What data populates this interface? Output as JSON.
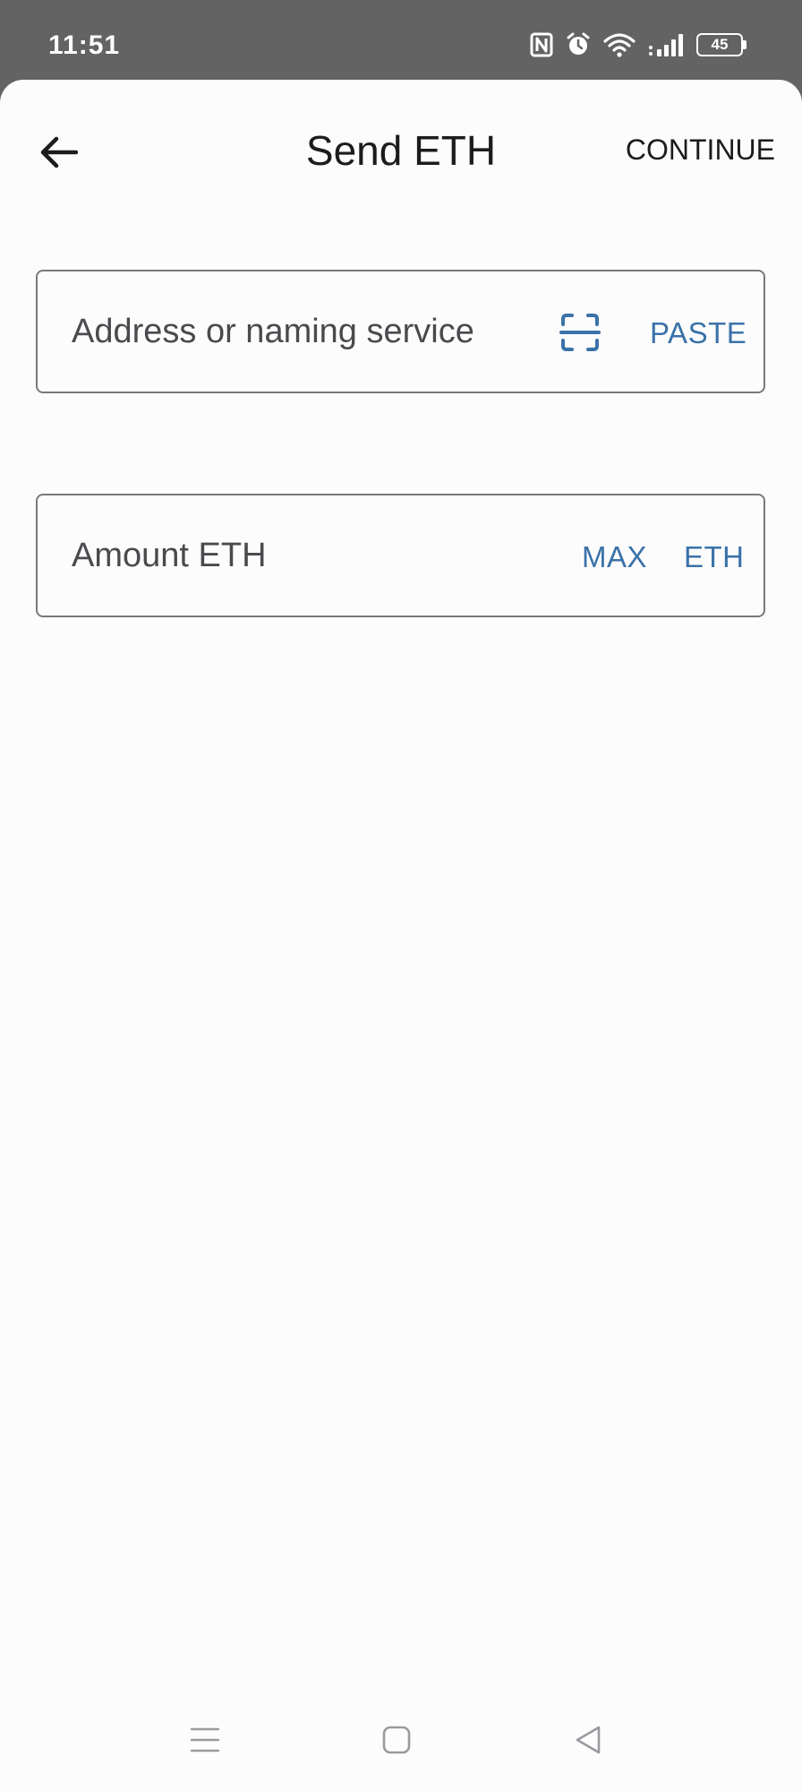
{
  "status_bar": {
    "time": "11:51",
    "battery_level": "45",
    "icons": [
      "nfc-icon",
      "alarm-icon",
      "wifi-icon",
      "signal-icon",
      "battery-icon"
    ]
  },
  "app_bar": {
    "title": "Send ETH",
    "continue_label": "CONTINUE",
    "back_icon": "arrow-left-icon"
  },
  "address_field": {
    "value": "",
    "placeholder": "Address or naming service",
    "scan_icon": "qr-scan-icon",
    "paste_label": "PASTE"
  },
  "amount_field": {
    "value": "",
    "placeholder": "Amount ETH",
    "max_label": "MAX",
    "unit_label": "ETH"
  },
  "nav_bar": {
    "icons": [
      "menu-icon",
      "home-icon",
      "back-triangle-icon"
    ]
  },
  "colors": {
    "accent": "#3a72a8",
    "text": "#1c1c1e",
    "status_bar": "#636363",
    "background": "#fdfcfd",
    "field_border": "#797979"
  }
}
